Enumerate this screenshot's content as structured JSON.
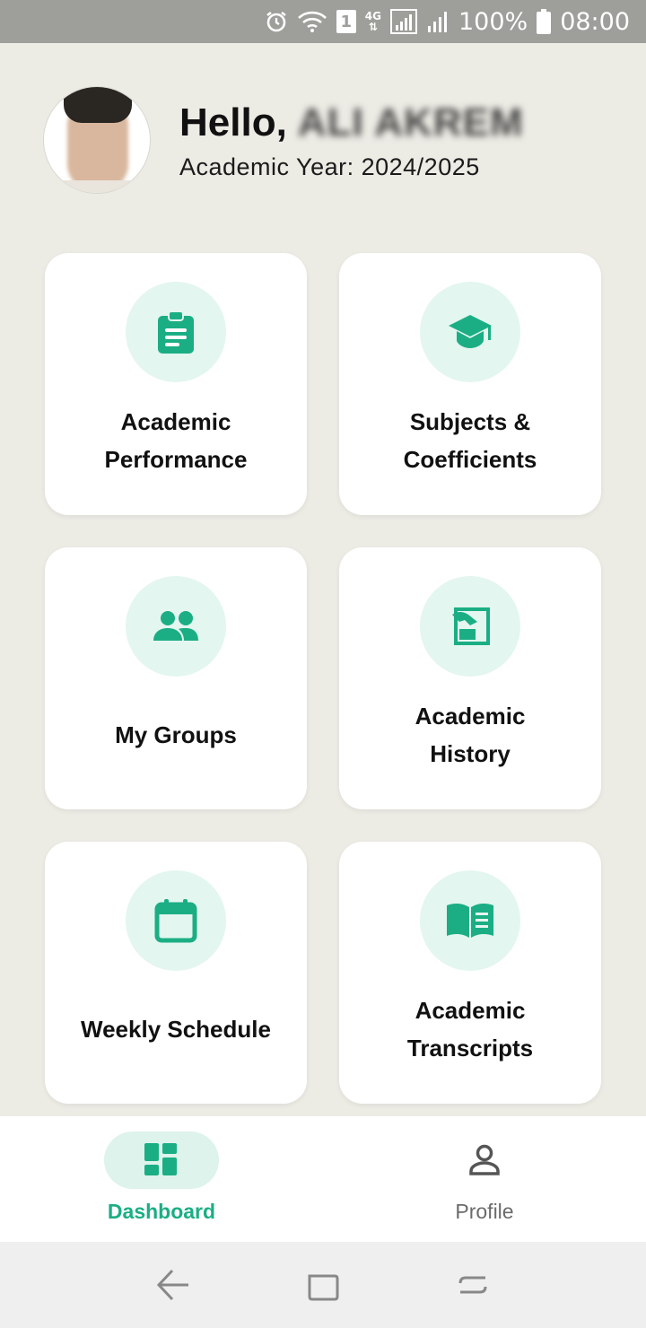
{
  "status_bar": {
    "sim_label": "1",
    "network_label": "4G",
    "battery": "100%",
    "time": "08:00",
    "icons": [
      "alarm-icon",
      "wifi-icon",
      "sim-icon",
      "network-4g-icon",
      "signal-icon",
      "signal-icon",
      "battery-icon"
    ]
  },
  "header": {
    "greeting": "Hello,",
    "user_name": "ALI AKREM",
    "academic_year": "Academic Year: 2024/2025"
  },
  "cards": [
    {
      "label": "Academic\nPerformance",
      "icon": "clipboard-icon"
    },
    {
      "label": "Subjects &\nCoefficients",
      "icon": "graduation-cap-icon"
    },
    {
      "label": "My Groups",
      "icon": "groups-icon"
    },
    {
      "label": "Academic\nHistory",
      "icon": "history-icon"
    },
    {
      "label": "Weekly Schedule",
      "icon": "calendar-icon"
    },
    {
      "label": "Academic\nTranscripts",
      "icon": "book-icon"
    }
  ],
  "bottom_nav": {
    "items": [
      {
        "label": "Dashboard",
        "icon": "dashboard-icon",
        "active": true
      },
      {
        "label": "Profile",
        "icon": "profile-icon",
        "active": false
      }
    ]
  },
  "system_nav": {
    "icons": [
      "back-icon",
      "recents-icon",
      "home-icon"
    ]
  },
  "colors": {
    "accent": "#1BAE84",
    "icon_circle": "#E3F6EF",
    "background": "#ECEBE4",
    "status_bar": "#9E9E9A"
  }
}
